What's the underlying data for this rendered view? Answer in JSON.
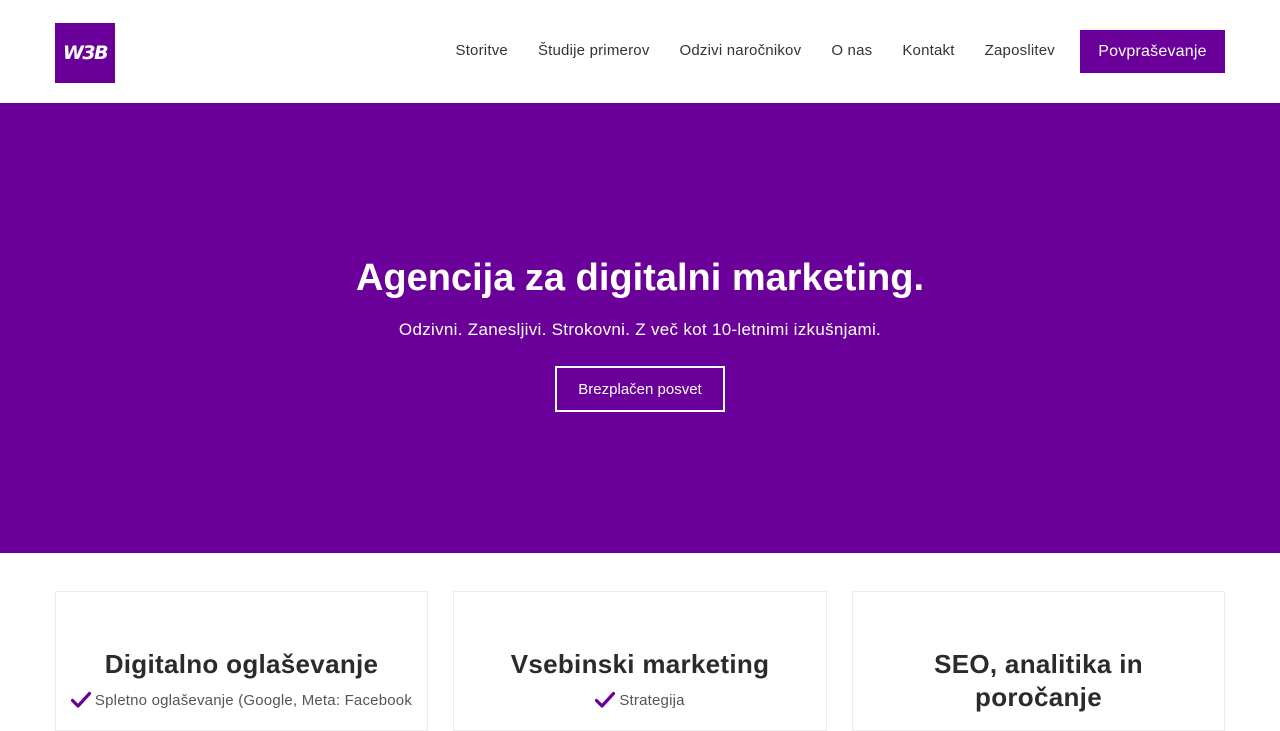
{
  "header": {
    "logo_text": "W3B",
    "nav": [
      "Storitve",
      "Študije primerov",
      "Odzivi naročnikov",
      "O nas",
      "Kontakt",
      "Zaposlitev"
    ],
    "cta_label": "Povpraševanje"
  },
  "hero": {
    "title": "Agencija za digitalni marketing.",
    "subtitle": "Odzivni. Zanesljivi. Strokovni. Z več kot 10-letnimi izkušnjami.",
    "button_label": "Brezplačen posvet"
  },
  "cards": [
    {
      "title": "Digitalno oglaševanje",
      "item": "Spletno oglaševanje (Google, Meta: Facebook"
    },
    {
      "title": "Vsebinski marketing",
      "item": "Strategija"
    },
    {
      "title": "SEO, analitika in poročanje"
    }
  ],
  "colors": {
    "brand": "#6a0099",
    "text": "#333333",
    "white": "#ffffff"
  },
  "icons": {
    "check": "check-icon"
  }
}
